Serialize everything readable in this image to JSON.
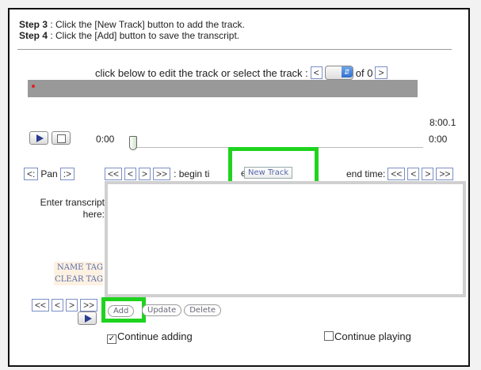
{
  "steps": [
    {
      "label": "Step 3",
      "text": " : Click the [New Track] button to add the track."
    },
    {
      "label": "Step 4",
      "text": " : Click the [Add] button to save the transcript."
    }
  ],
  "track_select": {
    "prompt": "click below to edit the track or select the track :",
    "prev": "<",
    "next": ">",
    "of_text": "of 0"
  },
  "timeline": {
    "duration": "8:00.1"
  },
  "player": {
    "current_time": "0:00",
    "end_time": "0:00"
  },
  "pan": {
    "left": "<:",
    "label": "Pan",
    "right": ":>"
  },
  "nav": {
    "first": "<<",
    "prev": "<",
    "next": ">",
    "last": ">>"
  },
  "begin_time_label": ": begin ti",
  "begin_time_tail": "e",
  "new_track_label": "New Track",
  "end_time_label": "end time:",
  "transcript": {
    "label": "Enter transcript here:",
    "value": ""
  },
  "tags": {
    "name": "NAME TAG",
    "clear": "CLEAR TAG"
  },
  "buttons": {
    "add": "Add",
    "update": "Update",
    "delete": "Delete"
  },
  "options": {
    "continue_adding": {
      "label": "Continue adding",
      "checked": true
    },
    "continue_playing": {
      "label": "Continue playing",
      "checked": false
    }
  },
  "colors": {
    "highlight": "#1fd31f",
    "timeline": "#999999",
    "accent": "#2a3d8f"
  }
}
